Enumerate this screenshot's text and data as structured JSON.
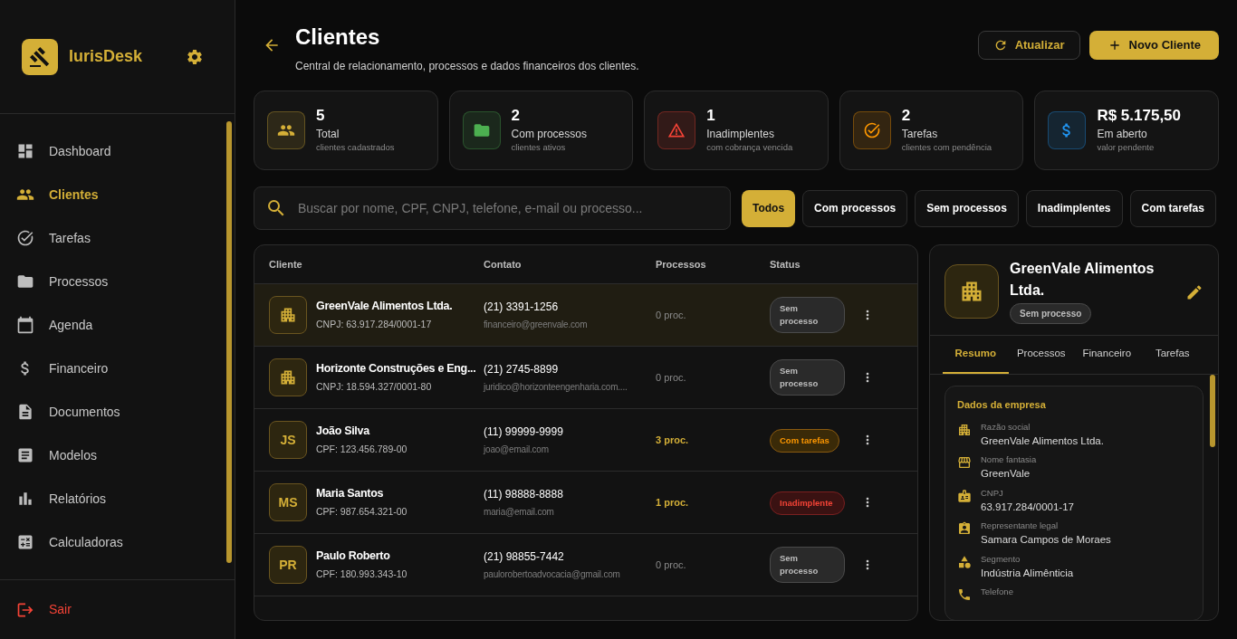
{
  "brand": {
    "name": "IurisDesk"
  },
  "sidebar": {
    "items": [
      {
        "label": "Dashboard",
        "selected": false
      },
      {
        "label": "Clientes",
        "selected": true
      },
      {
        "label": "Tarefas",
        "selected": false
      },
      {
        "label": "Processos",
        "selected": false
      },
      {
        "label": "Agenda",
        "selected": false
      },
      {
        "label": "Financeiro",
        "selected": false
      },
      {
        "label": "Documentos",
        "selected": false
      },
      {
        "label": "Modelos",
        "selected": false
      },
      {
        "label": "Relatórios",
        "selected": false
      },
      {
        "label": "Calculadoras",
        "selected": false
      }
    ],
    "logout": "Sair"
  },
  "header": {
    "title": "Clientes",
    "subtitle": "Central de relacionamento, processos e dados financeiros dos clientes.",
    "refresh_button": "Atualizar",
    "new_button": "Novo Cliente"
  },
  "stats": [
    {
      "color": "#d4af37",
      "value": "5",
      "label": "Total",
      "caption": "clientes cadastrados"
    },
    {
      "color": "#4caf50",
      "value": "2",
      "label": "Com processos",
      "caption": "clientes ativos"
    },
    {
      "color": "#f44336",
      "value": "1",
      "label": "Inadimplentes",
      "caption": "com cobrança vencida"
    },
    {
      "color": "#ff9800",
      "value": "2",
      "label": "Tarefas",
      "caption": "clientes com pendência"
    },
    {
      "color": "#2196f3",
      "value": "R$ 5.175,50",
      "label": "Em aberto",
      "caption": "valor pendente"
    }
  ],
  "search": {
    "placeholder": "Buscar por nome, CPF, CNPJ, telefone, e-mail ou processo..."
  },
  "filters": [
    {
      "label": "Todos",
      "selected": true
    },
    {
      "label": "Com processos",
      "selected": false
    },
    {
      "label": "Sem processos",
      "selected": false
    },
    {
      "label": "Inadimplentes",
      "selected": false
    },
    {
      "label": "Com tarefas",
      "selected": false
    }
  ],
  "table": {
    "columns": [
      "Cliente",
      "Contato",
      "Processos",
      "Status"
    ],
    "rows": [
      {
        "name": "GreenVale Alimentos Ltda.",
        "document": "CNPJ: 63.917.284/0001-17",
        "phone": "(21) 3391-1256",
        "email": "financeiro@greenvale.com",
        "processes": "0 proc.",
        "has_processes": false,
        "status": {
          "text": "Sem processo",
          "kind": "none"
        },
        "selected": true
      },
      {
        "name": "Horizonte Construções e Eng...",
        "document": "CNPJ: 18.594.327/0001-80",
        "phone": "(21) 2745-8899",
        "email": "juridico@horizonteengenharia.com....",
        "processes": "0 proc.",
        "has_processes": false,
        "status": {
          "text": "Sem processo",
          "kind": "none"
        },
        "selected": false
      },
      {
        "initials": "JS",
        "name": "João Silva",
        "document": "CPF: 123.456.789-00",
        "phone": "(11) 99999-9999",
        "email": "joao@email.com",
        "processes": "3 proc.",
        "has_processes": true,
        "status": {
          "text": "Com tarefas",
          "kind": "tasks"
        },
        "selected": false
      },
      {
        "initials": "MS",
        "name": "Maria Santos",
        "document": "CPF: 987.654.321-00",
        "phone": "(11) 98888-8888",
        "email": "maria@email.com",
        "processes": "1 proc.",
        "has_processes": true,
        "status": {
          "text": "Inadimplente",
          "kind": "overdue"
        },
        "selected": false
      },
      {
        "initials": "PR",
        "name": "Paulo Roberto",
        "document": "CPF: 180.993.343-10",
        "phone": "(21) 98855-7442",
        "email": "paulorobertoadvocacia@gmail.com",
        "processes": "0 proc.",
        "has_processes": false,
        "status": {
          "text": "Sem processo",
          "kind": "none"
        },
        "selected": false
      }
    ]
  },
  "detail": {
    "name": "GreenVale Alimentos Ltda.",
    "status": {
      "text": "Sem processo",
      "kind": "none"
    },
    "tabs": [
      {
        "label": "Resumo",
        "selected": true
      },
      {
        "label": "Processos",
        "selected": false
      },
      {
        "label": "Financeiro",
        "selected": false
      },
      {
        "label": "Tarefas",
        "selected": false
      }
    ],
    "section_title": "Dados da empresa",
    "fields": [
      {
        "label": "Razão social",
        "value": "GreenVale Alimentos Ltda."
      },
      {
        "label": "Nome fantasia",
        "value": "GreenVale"
      },
      {
        "label": "CNPJ",
        "value": "63.917.284/0001-17"
      },
      {
        "label": "Representante legal",
        "value": "Samara Campos de Moraes"
      },
      {
        "label": "Segmento",
        "value": "Indústria Alimênticia"
      },
      {
        "label": "Telefone"
      }
    ]
  }
}
